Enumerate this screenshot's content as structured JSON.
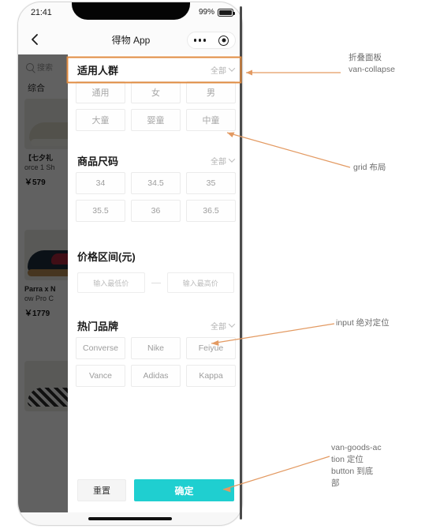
{
  "status_bar": {
    "time": "21:41",
    "battery_pct": "99%"
  },
  "nav_bar": {
    "title": "得物 App",
    "back_icon": "chevron-left-icon",
    "capsule_more_icon": "more-dots-icon",
    "capsule_target_icon": "target-circle-icon"
  },
  "background": {
    "search_placeholder": "搜索",
    "tab_label": "综合",
    "cards": [
      {
        "title": "【七夕礼",
        "subtitle": "orce 1 Sh",
        "price": "￥579"
      },
      {
        "title": "Parra x N",
        "subtitle": "ow Pro C",
        "price": "￥1779"
      }
    ]
  },
  "panel": {
    "sections": [
      {
        "title": "适用人群",
        "all_label": "全部",
        "chevron_icon": "chevron-down-icon",
        "options": [
          "通用",
          "女",
          "男",
          "大童",
          "婴童",
          "中童"
        ],
        "latin": false
      },
      {
        "title": "商品尺码",
        "all_label": "全部",
        "chevron_icon": "chevron-down-icon",
        "options": [
          "34",
          "34.5",
          "35",
          "35.5",
          "36",
          "36.5"
        ],
        "latin": true
      }
    ],
    "price_section": {
      "title": "价格区间(元)",
      "min_placeholder": "输入最低价",
      "max_placeholder": "输入最高价",
      "separator": "—"
    },
    "brand_section": {
      "title": "热门品牌",
      "all_label": "全部",
      "chevron_icon": "chevron-down-icon",
      "options": [
        "Converse",
        "Nike",
        "Feiyue",
        "Vance",
        "Adidas",
        "Kappa"
      ]
    },
    "actions": {
      "reset_label": "重置",
      "confirm_label": "确定"
    }
  },
  "annotations": [
    {
      "line1": "折叠面板",
      "line2": "van-collapse"
    },
    {
      "line1": "grid 布局",
      "line2": ""
    },
    {
      "line1": "input 绝对定位",
      "line2": ""
    },
    {
      "line1": "van-goods-ac",
      "line2": "tion 定位",
      "line3": "button 到底",
      "line4": "部"
    }
  ],
  "colors": {
    "accent": "#1fcfd0",
    "annotation_arrow": "#e39a62",
    "highlight_box": "#e08b40"
  }
}
